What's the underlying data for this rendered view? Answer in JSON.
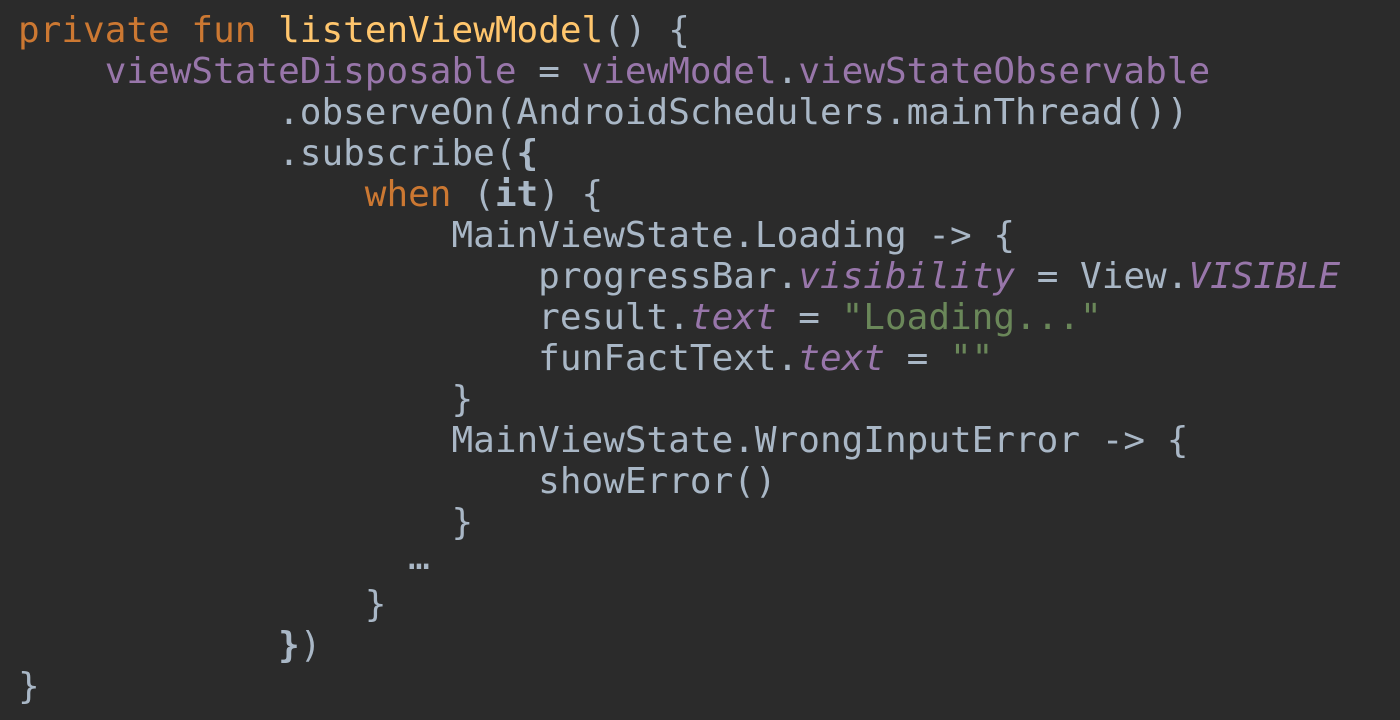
{
  "lines": [
    {
      "indent": "",
      "tokens": [
        {
          "text": "private",
          "cls": "kw"
        },
        {
          "text": " ",
          "cls": ""
        },
        {
          "text": "fun",
          "cls": "kw"
        },
        {
          "text": " ",
          "cls": ""
        },
        {
          "text": "listenViewModel",
          "cls": "fn"
        },
        {
          "text": "() {",
          "cls": ""
        }
      ]
    },
    {
      "indent": "    ",
      "tokens": [
        {
          "text": "viewStateDisposable",
          "cls": "prop"
        },
        {
          "text": " = ",
          "cls": ""
        },
        {
          "text": "viewModel",
          "cls": "prop"
        },
        {
          "text": ".",
          "cls": ""
        },
        {
          "text": "viewStateObservable",
          "cls": "prop"
        }
      ]
    },
    {
      "indent": "            ",
      "tokens": [
        {
          "text": ".observeOn(AndroidSchedulers.mainThread())",
          "cls": ""
        }
      ]
    },
    {
      "indent": "            ",
      "tokens": [
        {
          "text": ".subscribe(",
          "cls": ""
        },
        {
          "text": "{",
          "cls": "bold"
        }
      ]
    },
    {
      "indent": "                ",
      "tokens": [
        {
          "text": "when",
          "cls": "kw"
        },
        {
          "text": " (",
          "cls": ""
        },
        {
          "text": "it",
          "cls": "bold"
        },
        {
          "text": ") {",
          "cls": ""
        }
      ]
    },
    {
      "indent": "                    ",
      "tokens": [
        {
          "text": "MainViewState.Loading -> {",
          "cls": ""
        }
      ]
    },
    {
      "indent": "                        ",
      "tokens": [
        {
          "text": "progressBar.",
          "cls": ""
        },
        {
          "text": "visibility",
          "cls": "prop italic"
        },
        {
          "text": " = View.",
          "cls": ""
        },
        {
          "text": "VISIBLE",
          "cls": "prop italic"
        }
      ]
    },
    {
      "indent": "                        ",
      "tokens": [
        {
          "text": "result.",
          "cls": ""
        },
        {
          "text": "text",
          "cls": "prop italic"
        },
        {
          "text": " = ",
          "cls": ""
        },
        {
          "text": "\"Loading...\"",
          "cls": "str"
        }
      ]
    },
    {
      "indent": "                        ",
      "tokens": [
        {
          "text": "funFactText.",
          "cls": ""
        },
        {
          "text": "text",
          "cls": "prop italic"
        },
        {
          "text": " = ",
          "cls": ""
        },
        {
          "text": "\"\"",
          "cls": "str"
        }
      ]
    },
    {
      "indent": "                    ",
      "tokens": [
        {
          "text": "}",
          "cls": ""
        }
      ]
    },
    {
      "indent": "                    ",
      "tokens": [
        {
          "text": "MainViewState.WrongInputError -> {",
          "cls": ""
        }
      ]
    },
    {
      "indent": "                        ",
      "tokens": [
        {
          "text": "showError()",
          "cls": ""
        }
      ]
    },
    {
      "indent": "                    ",
      "tokens": [
        {
          "text": "}",
          "cls": ""
        }
      ]
    },
    {
      "indent": "                  ",
      "tokens": [
        {
          "text": "…",
          "cls": ""
        }
      ],
      "special": "ellipsis"
    },
    {
      "indent": "                ",
      "tokens": [
        {
          "text": "}",
          "cls": ""
        }
      ]
    },
    {
      "indent": "            ",
      "tokens": [
        {
          "text": "}",
          "cls": "bold"
        },
        {
          "text": ")",
          "cls": ""
        }
      ]
    },
    {
      "indent": "",
      "tokens": [
        {
          "text": "}",
          "cls": ""
        }
      ]
    }
  ],
  "colors": {
    "background": "#2b2b2b",
    "default_text": "#a9b7c6",
    "keyword": "#cc7832",
    "function_name": "#ffc66d",
    "property": "#9876aa",
    "string": "#6a8759"
  }
}
